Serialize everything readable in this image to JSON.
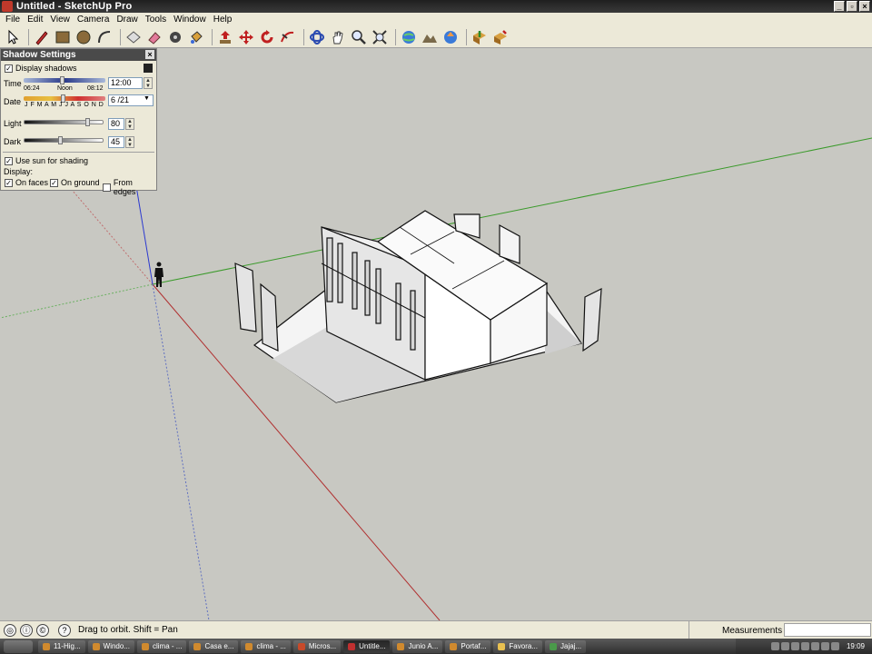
{
  "window": {
    "title": "Untitled - SketchUp Pro"
  },
  "menu": [
    "File",
    "Edit",
    "View",
    "Camera",
    "Draw",
    "Tools",
    "Window",
    "Help"
  ],
  "toolbar": {
    "tools": [
      "select",
      "pencil",
      "rectangle",
      "circle",
      "arc",
      "make-component",
      "eraser",
      "tape-measure",
      "paint-bucket",
      "push-pull",
      "move",
      "rotate",
      "follow-me",
      "orbit",
      "pan",
      "zoom",
      "zoom-extents",
      "get-models",
      "share-model",
      "share-component",
      "get-photo-texture",
      "preview-google-earth"
    ]
  },
  "shadow_panel": {
    "title": "Shadow Settings",
    "display_shadows_label": "Display shadows",
    "display_shadows": true,
    "time_label": "Time",
    "time_ticks": [
      "06:24",
      "Noon",
      "08:12"
    ],
    "time_value": "12:00",
    "date_label": "Date",
    "date_months": "J F M A M J  J A S O N D",
    "date_value": "6 /21",
    "light_label": "Light",
    "light_value": "80",
    "dark_label": "Dark",
    "dark_value": "45",
    "use_sun_label": "Use sun for shading",
    "use_sun": true,
    "display_label": "Display:",
    "on_faces_label": "On faces",
    "on_faces": true,
    "on_ground_label": "On ground",
    "on_ground": true,
    "from_edges_label": "From edges",
    "from_edges": false
  },
  "status": {
    "hint": "Drag to orbit.  Shift = Pan",
    "measurements_label": "Measurements"
  },
  "taskbar": {
    "buttons": [
      "11-Hig...",
      "Windo...",
      "clima - ...",
      "Casa e...",
      "clima - ...",
      "Micros...",
      "Untitle...",
      "Junio A...",
      "Portaf...",
      "Favora...",
      "Jajaj..."
    ],
    "active_index": 6,
    "clock": "19:09"
  },
  "colors": {
    "viewport_bg": "#c8c8c2",
    "axis_red": "#b03030",
    "axis_green": "#3a9a2a",
    "axis_blue": "#2c3ad0"
  }
}
